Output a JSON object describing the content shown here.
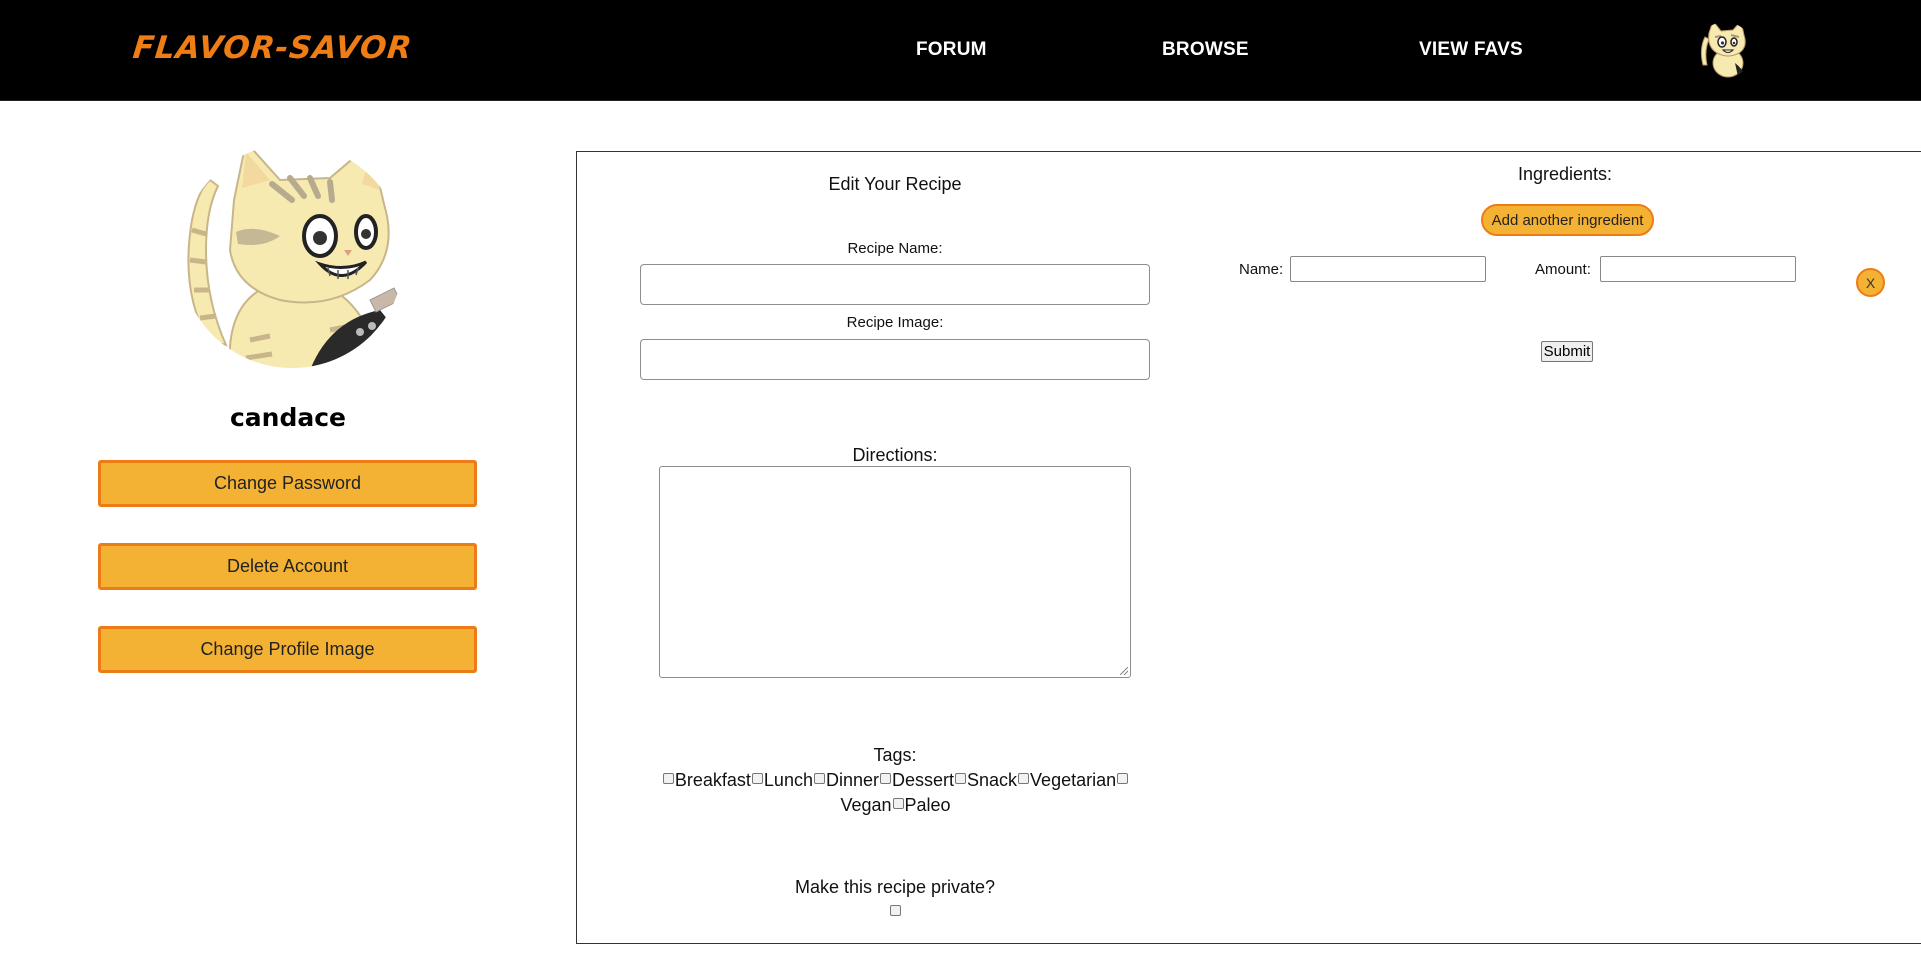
{
  "header": {
    "logo": "FLAVOR-SAVOR",
    "nav": [
      {
        "label": "FORUM"
      },
      {
        "label": "BROWSE"
      },
      {
        "label": "VIEW FAVS"
      }
    ],
    "avatar_icon": "cat-avatar-icon"
  },
  "profile": {
    "avatar_icon": "cat-avatar-icon",
    "username": "candace",
    "buttons": [
      {
        "label": "Change Password"
      },
      {
        "label": "Delete Account"
      },
      {
        "label": "Change Profile Image"
      }
    ]
  },
  "form": {
    "title": "Edit Your Recipe",
    "recipe_name_label": "Recipe Name:",
    "recipe_name_value": "",
    "recipe_image_label": "Recipe Image:",
    "recipe_image_value": "",
    "directions_label": "Directions:",
    "directions_value": "",
    "tags_label": "Tags:",
    "tags": [
      {
        "label": "Breakfast",
        "checked": false
      },
      {
        "label": "Lunch",
        "checked": false
      },
      {
        "label": "Dinner",
        "checked": false
      },
      {
        "label": "Dessert",
        "checked": false
      },
      {
        "label": "Snack",
        "checked": false
      },
      {
        "label": "Vegetarian",
        "checked": false
      },
      {
        "label": "Vegan",
        "checked": false
      },
      {
        "label": "Paleo",
        "checked": false
      }
    ],
    "private_label": "Make this recipe private?",
    "private_checked": false
  },
  "ingredients": {
    "title": "Ingredients:",
    "add_label": "Add another ingredient",
    "name_label": "Name:",
    "name_value": "",
    "amount_label": "Amount:",
    "amount_value": "",
    "remove_label": "X",
    "submit_label": "Submit"
  },
  "colors": {
    "header_bg": "#000000",
    "logo": "#ef7d16",
    "button_fill": "#f4b234",
    "button_border": "#ee7c16"
  }
}
